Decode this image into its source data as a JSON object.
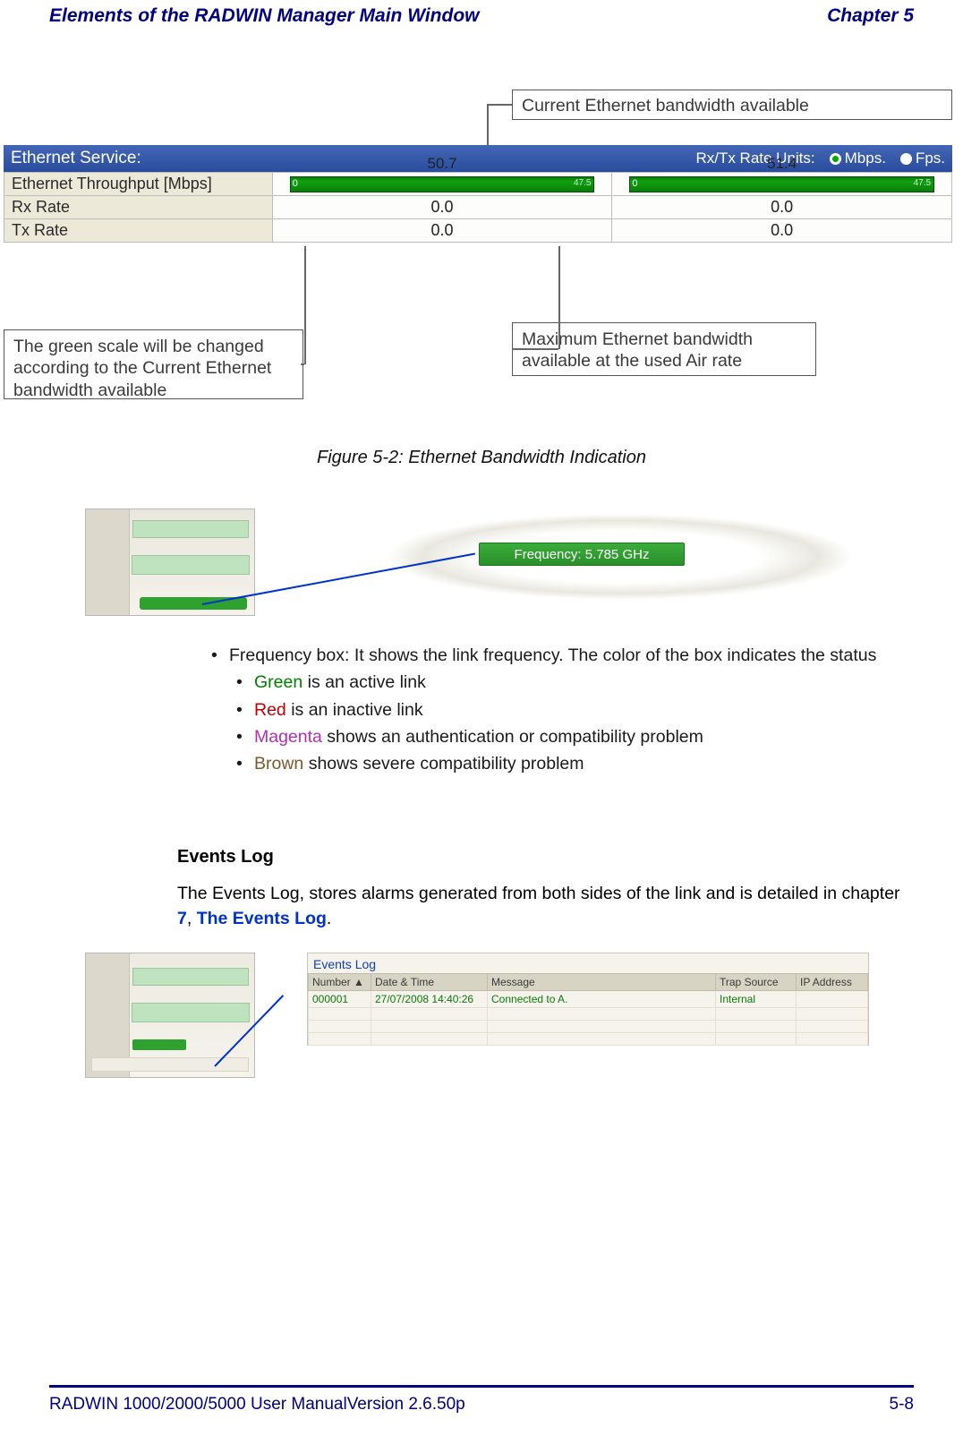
{
  "header": {
    "left": "Elements of the RADWIN Manager Main Window",
    "right": "Chapter 5"
  },
  "fig1": {
    "callouts": {
      "top": "Current Ethernet bandwidth available",
      "bottom_left": "The green scale will be changed according to the Current Ethernet bandwidth available",
      "bottom_right": "Maximum Ethernet bandwidth available at the used Air rate"
    },
    "service_bar": {
      "left": "Ethernet Service:",
      "right_label": "Rx/Tx Rate Units:",
      "opt_mbps": "Mbps.",
      "opt_fps": "Fps."
    },
    "rows": {
      "throughput_label": "Ethernet Throughput [Mbps]",
      "rx_label": "Rx Rate",
      "tx_label": "Tx Rate"
    },
    "values": {
      "col1_top": "50.7",
      "col2_top": "51.4",
      "bar_end_1": "47.5",
      "bar_end_2": "47.5",
      "col1_rx": "0.0",
      "col2_rx": "0.0",
      "col1_tx": "0.0",
      "col2_tx": "0.0",
      "bar_start": "0"
    },
    "caption": "Figure 5-2: Ethernet Bandwidth Indication"
  },
  "freq": {
    "pill": "Frequency: 5.785 GHz"
  },
  "text": {
    "bullet_intro": "Frequency box: It shows the link frequency. The color of the box indicates the status",
    "green_word": "Green",
    "green_rest": " is an active link",
    "red_word": "Red",
    "red_rest": " is an inactive link",
    "magenta_word": "Magenta",
    "magenta_rest": " shows an authentication or compatibility problem",
    "brown_word": "Brown",
    "brown_rest": " shows severe compatibility problem"
  },
  "events": {
    "heading": "Events Log",
    "para_a": "The Events Log, stores alarms generated from both sides of the link and is detailed in chapter ",
    "ch_num": "7",
    "comma_sep": ", ",
    "link_text": "The Events Log",
    "period": "."
  },
  "ev_panel": {
    "title": "Events Log",
    "cols": {
      "num": "Number  ▲",
      "date": "Date & Time",
      "msg": "Message",
      "trap": "Trap Source",
      "ip": "IP Address"
    },
    "row": {
      "num": "000001",
      "date": "27/07/2008 14:40:26",
      "msg": "Connected to A.",
      "trap": "Internal",
      "ip": ""
    }
  },
  "footer": {
    "left_a": "RADWIN 1000/2000/5000 User Manual",
    "left_b": "Version  2.6.50p",
    "right": "5-8"
  }
}
